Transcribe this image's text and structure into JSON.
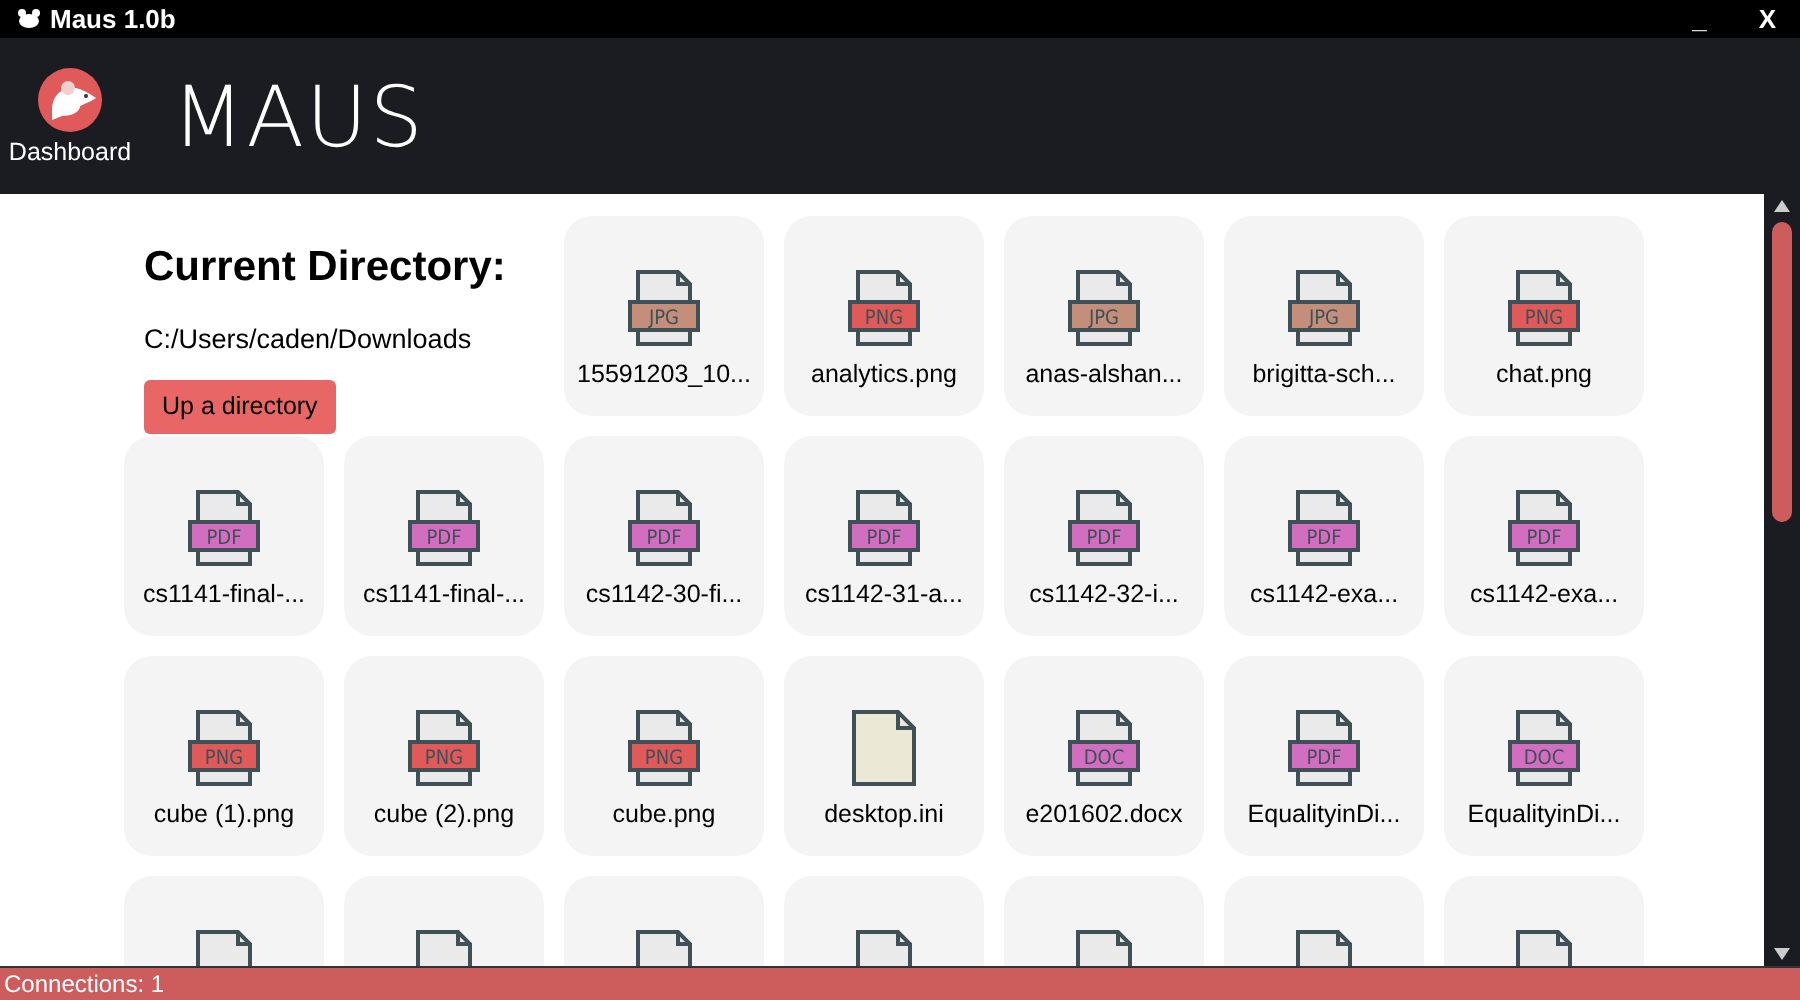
{
  "window": {
    "title": "Maus 1.0b",
    "controls": [
      "_",
      "X"
    ]
  },
  "header": {
    "nav_label": "Dashboard",
    "app_name": "MAUS"
  },
  "directory": {
    "heading": "Current Directory:",
    "path": "C:/Users/caden/Downloads",
    "up_button": "Up a directory"
  },
  "files": [
    {
      "kind": "file",
      "name": "15591203_10...",
      "label": "JPG",
      "color": "#c48f7a"
    },
    {
      "kind": "file",
      "name": "analytics.png",
      "label": "PNG",
      "color": "#e05a5a"
    },
    {
      "kind": "file",
      "name": "anas-alshan...",
      "label": "JPG",
      "color": "#c48f7a"
    },
    {
      "kind": "file",
      "name": "brigitta-sch...",
      "label": "JPG",
      "color": "#c48f7a"
    },
    {
      "kind": "file",
      "name": "chat.png",
      "label": "PNG",
      "color": "#e05a5a"
    },
    {
      "kind": "file",
      "name": "cs1141-final-...",
      "label": "PDF",
      "color": "#d26ec0"
    },
    {
      "kind": "file",
      "name": "cs1141-final-...",
      "label": "PDF",
      "color": "#d26ec0"
    },
    {
      "kind": "file",
      "name": "cs1142-30-fi...",
      "label": "PDF",
      "color": "#d26ec0"
    },
    {
      "kind": "file",
      "name": "cs1142-31-a...",
      "label": "PDF",
      "color": "#d26ec0"
    },
    {
      "kind": "file",
      "name": "cs1142-32-i...",
      "label": "PDF",
      "color": "#d26ec0"
    },
    {
      "kind": "file",
      "name": "cs1142-exa...",
      "label": "PDF",
      "color": "#d26ec0"
    },
    {
      "kind": "file",
      "name": "cs1142-exa...",
      "label": "PDF",
      "color": "#d26ec0"
    },
    {
      "kind": "file",
      "name": "cube (1).png",
      "label": "PNG",
      "color": "#e05a5a"
    },
    {
      "kind": "file",
      "name": "cube (2).png",
      "label": "PNG",
      "color": "#e05a5a"
    },
    {
      "kind": "file",
      "name": "cube.png",
      "label": "PNG",
      "color": "#e05a5a"
    },
    {
      "kind": "plain",
      "name": "desktop.ini"
    },
    {
      "kind": "file",
      "name": "e201602.docx",
      "label": "DOC",
      "color": "#d26ec0"
    },
    {
      "kind": "file",
      "name": "EqualityinDi...",
      "label": "PDF",
      "color": "#d26ec0"
    },
    {
      "kind": "file",
      "name": "EqualityinDi...",
      "label": "DOC",
      "color": "#d26ec0"
    },
    {
      "kind": "partial"
    },
    {
      "kind": "partial"
    },
    {
      "kind": "partial"
    },
    {
      "kind": "partial"
    },
    {
      "kind": "partial"
    },
    {
      "kind": "partial"
    },
    {
      "kind": "partial"
    }
  ],
  "status_bar": {
    "text": "Connections: 1"
  }
}
